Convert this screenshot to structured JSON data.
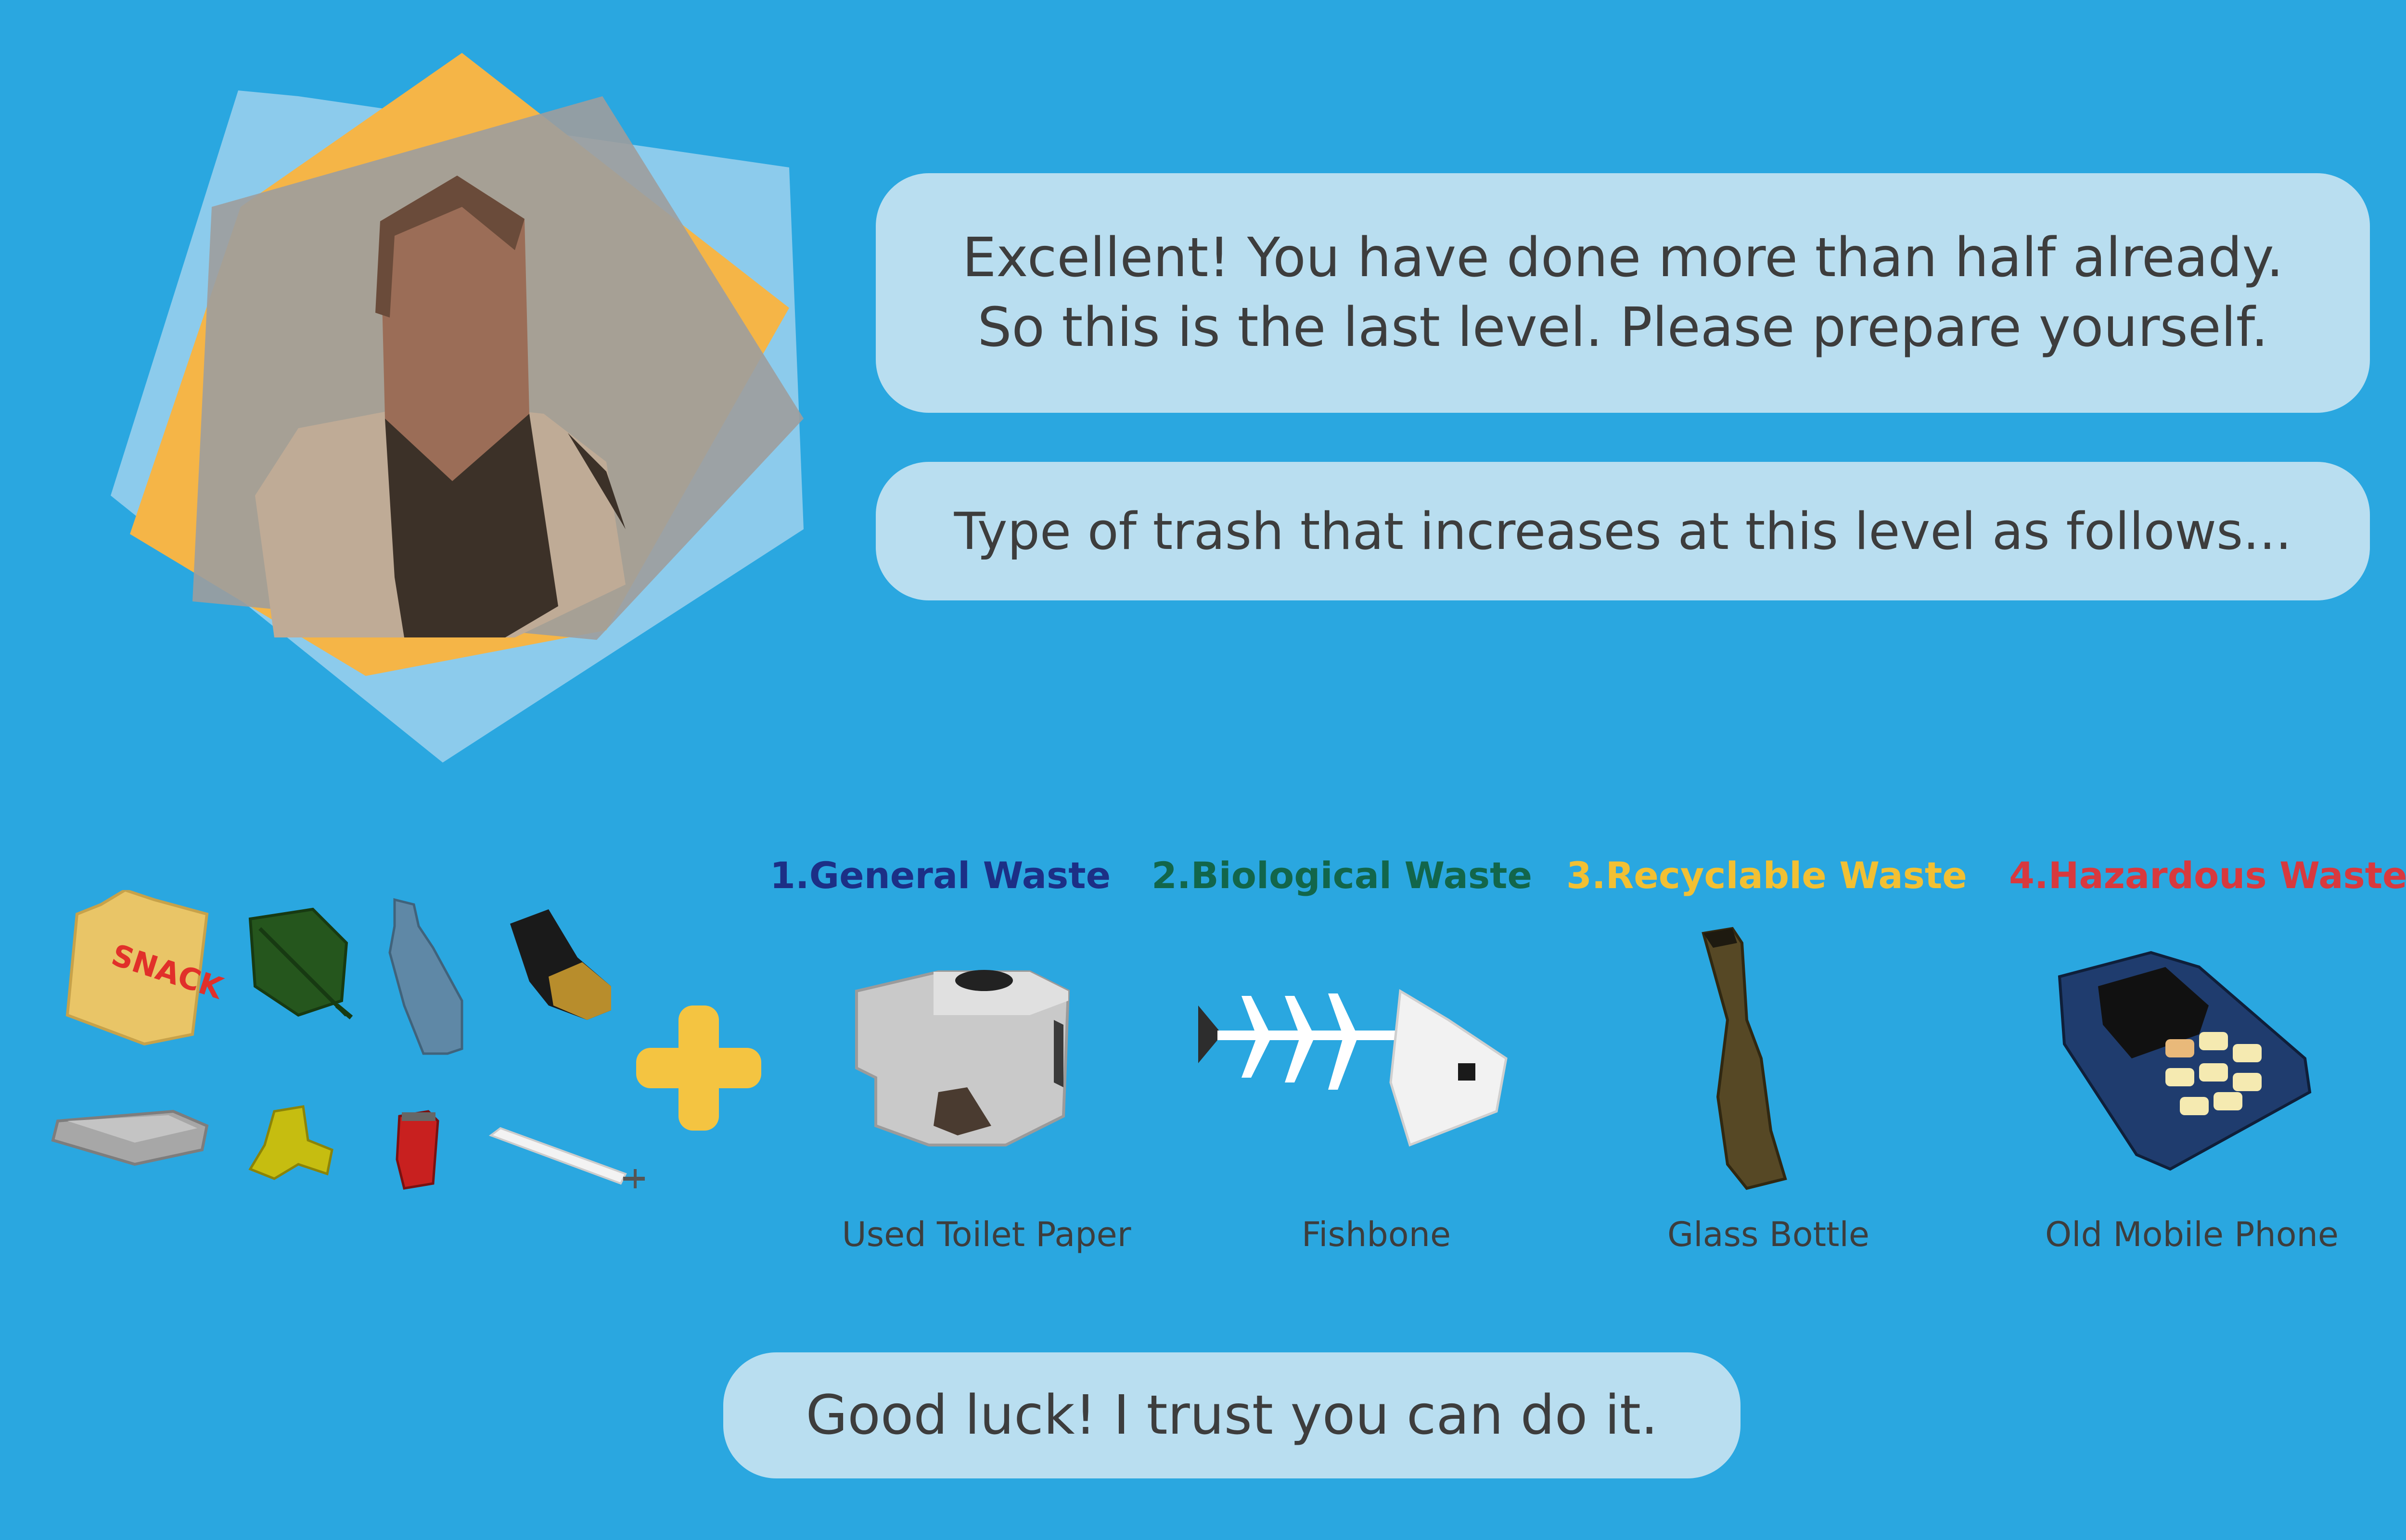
{
  "dialog": {
    "line1": "Excellent! You have done more than half already.",
    "line2": "So this is the last level. Please prepare yourself.",
    "intro": "Type of trash that increases at this level as follows...",
    "closing": "Good luck! I trust you can do it."
  },
  "categories": [
    {
      "num": "1.",
      "label": "General Waste",
      "color": "#1c2f86"
    },
    {
      "num": "2.",
      "label": "Biological Waste",
      "color": "#12664b"
    },
    {
      "num": "3.",
      "label": "Recyclable Waste",
      "color": "#f2c033"
    },
    {
      "num": "4.",
      "label": "Hazardous Waste",
      "color": "#d8393e"
    }
  ],
  "items": [
    {
      "label": "Used Toilet Paper",
      "icon": "toilet-paper-icon"
    },
    {
      "label": "Fishbone",
      "icon": "fishbone-icon"
    },
    {
      "label": "Glass Bottle",
      "icon": "glass-bottle-icon"
    },
    {
      "label": "Old Mobile Phone",
      "icon": "mobile-phone-icon"
    }
  ],
  "existing_trash": {
    "snack_label": "SNACK",
    "icons": [
      "snack-bag-icon",
      "leaf-icon",
      "plastic-bottle-icon",
      "battery-icon",
      "tray-icon",
      "banana-peel-icon",
      "soda-can-icon",
      "fluorescent-tube-icon"
    ]
  },
  "colors": {
    "background": "#2aa7e0",
    "bubble": "#b9def0",
    "plus": "#f4c441",
    "text": "#3d3d3d"
  }
}
